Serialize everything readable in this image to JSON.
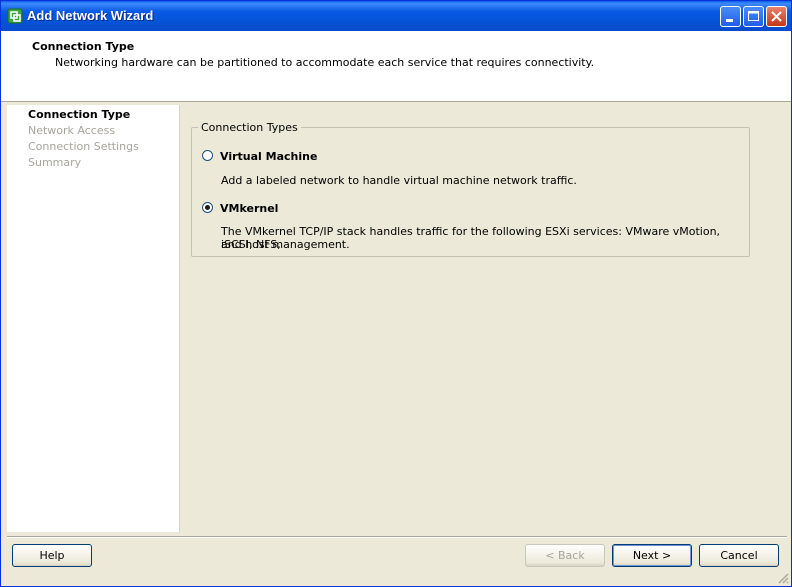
{
  "window": {
    "title": "Add Network Wizard"
  },
  "header": {
    "title": "Connection Type",
    "subtitle": "Networking hardware can be partitioned to accommodate each service that requires connectivity."
  },
  "sidebar": {
    "steps": [
      {
        "label": "Connection Type",
        "active": true
      },
      {
        "label": "Network Access",
        "active": false
      },
      {
        "label": "Connection Settings",
        "active": false
      },
      {
        "label": "Summary",
        "active": false
      }
    ]
  },
  "connection_types": {
    "legend": "Connection Types",
    "options": [
      {
        "label": "Virtual Machine",
        "description": "Add a labeled network to handle virtual machine network traffic.",
        "selected": false
      },
      {
        "label": "VMkernel",
        "description_line1": "The VMkernel TCP/IP stack handles traffic for the following ESXi services: VMware vMotion, iSCSI, NFS,",
        "description_line2": "and host management.",
        "selected": true
      }
    ]
  },
  "buttons": {
    "help": "Help",
    "back": "< Back",
    "next": "Next >",
    "cancel": "Cancel"
  },
  "colors": {
    "title_bar": "#0859e6",
    "dialog_bg": "#ece9d8",
    "disabled_text": "#a7a59b"
  },
  "icons": [
    "network-wizard-icon",
    "minimize-icon",
    "maximize-icon",
    "close-icon",
    "resize-grip-icon"
  ]
}
